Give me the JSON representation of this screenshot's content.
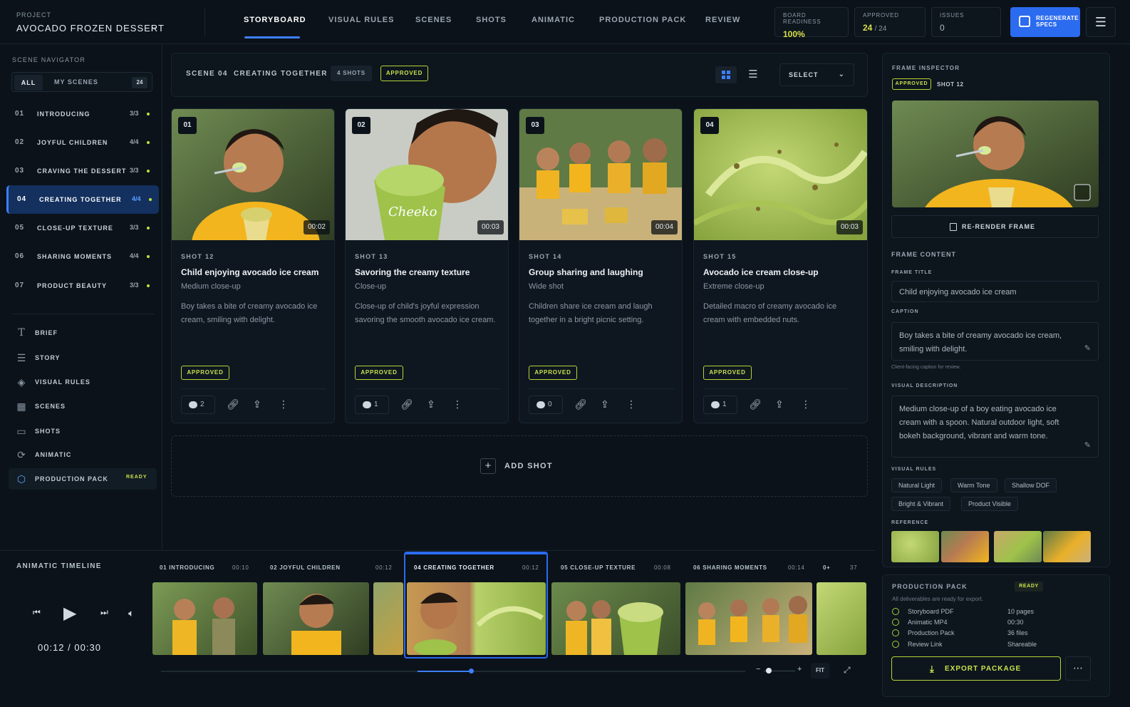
{
  "project": {
    "label": "PROJECT",
    "name": "AVOCADO FROZEN DESSERT"
  },
  "nav": [
    "STORYBOARD",
    "VISUAL RULES",
    "SCENES",
    "SHOTS",
    "ANIMATIC",
    "PRODUCTION PACK",
    "REVIEW"
  ],
  "stats": {
    "board_readiness": {
      "label": "BOARD READINESS",
      "value": "100%"
    },
    "approved": {
      "label": "APPROVED",
      "value": "24",
      "total": "/ 24"
    },
    "issues": {
      "label": "ISSUES",
      "value": "0"
    }
  },
  "regenerate": {
    "line1": "REGENERATE",
    "line2": "SPECS"
  },
  "sidebar": {
    "title": "SCENE NAVIGATOR",
    "tab_all": "ALL",
    "tab_my": "MY SCENES",
    "count": "24",
    "scenes": [
      {
        "num": "01",
        "title": "INTRODUCING",
        "count": "3/3"
      },
      {
        "num": "02",
        "title": "JOYFUL CHILDREN",
        "count": "4/4"
      },
      {
        "num": "03",
        "title": "CRAVING THE DESSERT",
        "count": "3/3"
      },
      {
        "num": "04",
        "title": "CREATING TOGETHER",
        "count": "4/4"
      },
      {
        "num": "05",
        "title": "CLOSE-UP TEXTURE",
        "count": "3/3"
      },
      {
        "num": "06",
        "title": "SHARING MOMENTS",
        "count": "4/4"
      },
      {
        "num": "07",
        "title": "PRODUCT BEAUTY",
        "count": "3/3"
      }
    ],
    "nav": [
      "BRIEF",
      "STORY",
      "VISUAL RULES",
      "SCENES",
      "SHOTS",
      "ANIMATIC",
      "PRODUCTION PACK"
    ],
    "production_pack_badge": "READY"
  },
  "scene_header": {
    "label": "SCENE 04",
    "title": "CREATING TOGETHER",
    "shots": "4 SHOTS",
    "status": "APPROVED",
    "select": "SELECT"
  },
  "shots": [
    {
      "index": "01",
      "duration": "00:02",
      "shot": "SHOT 12",
      "title": "Child enjoying avocado ice cream",
      "type": "Medium close-up",
      "desc": "Boy takes a bite of creamy avocado ice cream, smiling with delight.",
      "status": "APPROVED",
      "comments": "2"
    },
    {
      "index": "02",
      "duration": "00:03",
      "shot": "SHOT 13",
      "title": "Savoring the creamy texture",
      "type": "Close-up",
      "desc": "Close-up of child's joyful expression savoring the smooth avocado ice cream.",
      "status": "APPROVED",
      "comments": "1"
    },
    {
      "index": "03",
      "duration": "00:04",
      "shot": "SHOT 14",
      "title": "Group sharing and laughing",
      "type": "Wide shot",
      "desc": "Children share ice cream and laugh together in a bright picnic setting.",
      "status": "APPROVED",
      "comments": "0"
    },
    {
      "index": "04",
      "duration": "00:03",
      "shot": "SHOT 15",
      "title": "Avocado ice cream close-up",
      "type": "Extreme close-up",
      "desc": "Detailed macro of creamy avocado ice cream with embedded nuts.",
      "status": "APPROVED",
      "comments": "1"
    }
  ],
  "add_shot": "ADD SHOT",
  "timeline": {
    "title": "ANIMATIC TIMELINE",
    "current": "00:12",
    "total": "00:30",
    "progress": 0.4,
    "segments": [
      {
        "label": "01 INTRODUCING",
        "dur": "00:10"
      },
      {
        "label": "02 JOYFUL CHILDREN",
        "dur": "00:12"
      },
      {
        "label": "04 CREATING TOGETHER",
        "dur": "00:12"
      },
      {
        "label": "05 CLOSE-UP TEXTURE",
        "dur": "00:08"
      },
      {
        "label": "06 SHARING MOMENTS",
        "dur": "00:14"
      },
      {
        "label": "0+",
        "dur": "37"
      }
    ],
    "fit": "FIT"
  },
  "inspector": {
    "title": "FRAME INSPECTOR",
    "status": "APPROVED",
    "shot": "SHOT 12",
    "rerender": "RE-RENDER FRAME",
    "content_title": "FRAME CONTENT",
    "frame_title_label": "FRAME TITLE",
    "frame_title": "Child enjoying avocado ice cream",
    "caption_label": "CAPTION",
    "caption": "Boy takes a bite of creamy avocado ice cream, smiling with delight.",
    "caption_help": "Client-facing caption for review.",
    "visual_desc_label": "VISUAL DESCRIPTION",
    "visual_desc": "Medium close-up of a boy eating avocado ice cream with a spoon. Natural outdoor light, soft bokeh background, vibrant and warm tone.",
    "visual_rules_label": "VISUAL RULES",
    "rules": [
      "Natural Light",
      "Warm Tone",
      "Shallow DOF",
      "Bright & Vibrant",
      "Product Visible"
    ],
    "reference_label": "REFERENCE"
  },
  "production_pack": {
    "title": "PRODUCTION PACK",
    "badge": "READY",
    "subtitle": "All deliverables are ready for export.",
    "items": [
      {
        "name": "Storyboard PDF",
        "value": "10 pages"
      },
      {
        "name": "Animatic MP4",
        "value": "00:30"
      },
      {
        "name": "Production Pack",
        "value": "36 files"
      },
      {
        "name": "Review Link",
        "value": "Shareable"
      }
    ],
    "export": "EXPORT PACKAGE"
  },
  "colors": {
    "accent": "#2b6bf0",
    "approved": "#c9e24d",
    "background": "#0b1219"
  },
  "icons": [
    "chevron-down-icon",
    "regenerate-icon",
    "settings-icon",
    "grid-view-icon",
    "list-view-icon",
    "comment-icon",
    "link-icon",
    "share-icon",
    "more-icon",
    "plus-icon",
    "prev-icon",
    "play-icon",
    "next-icon",
    "volume-icon",
    "expand-icon",
    "edit-icon",
    "check-circle-icon",
    "download-icon"
  ]
}
